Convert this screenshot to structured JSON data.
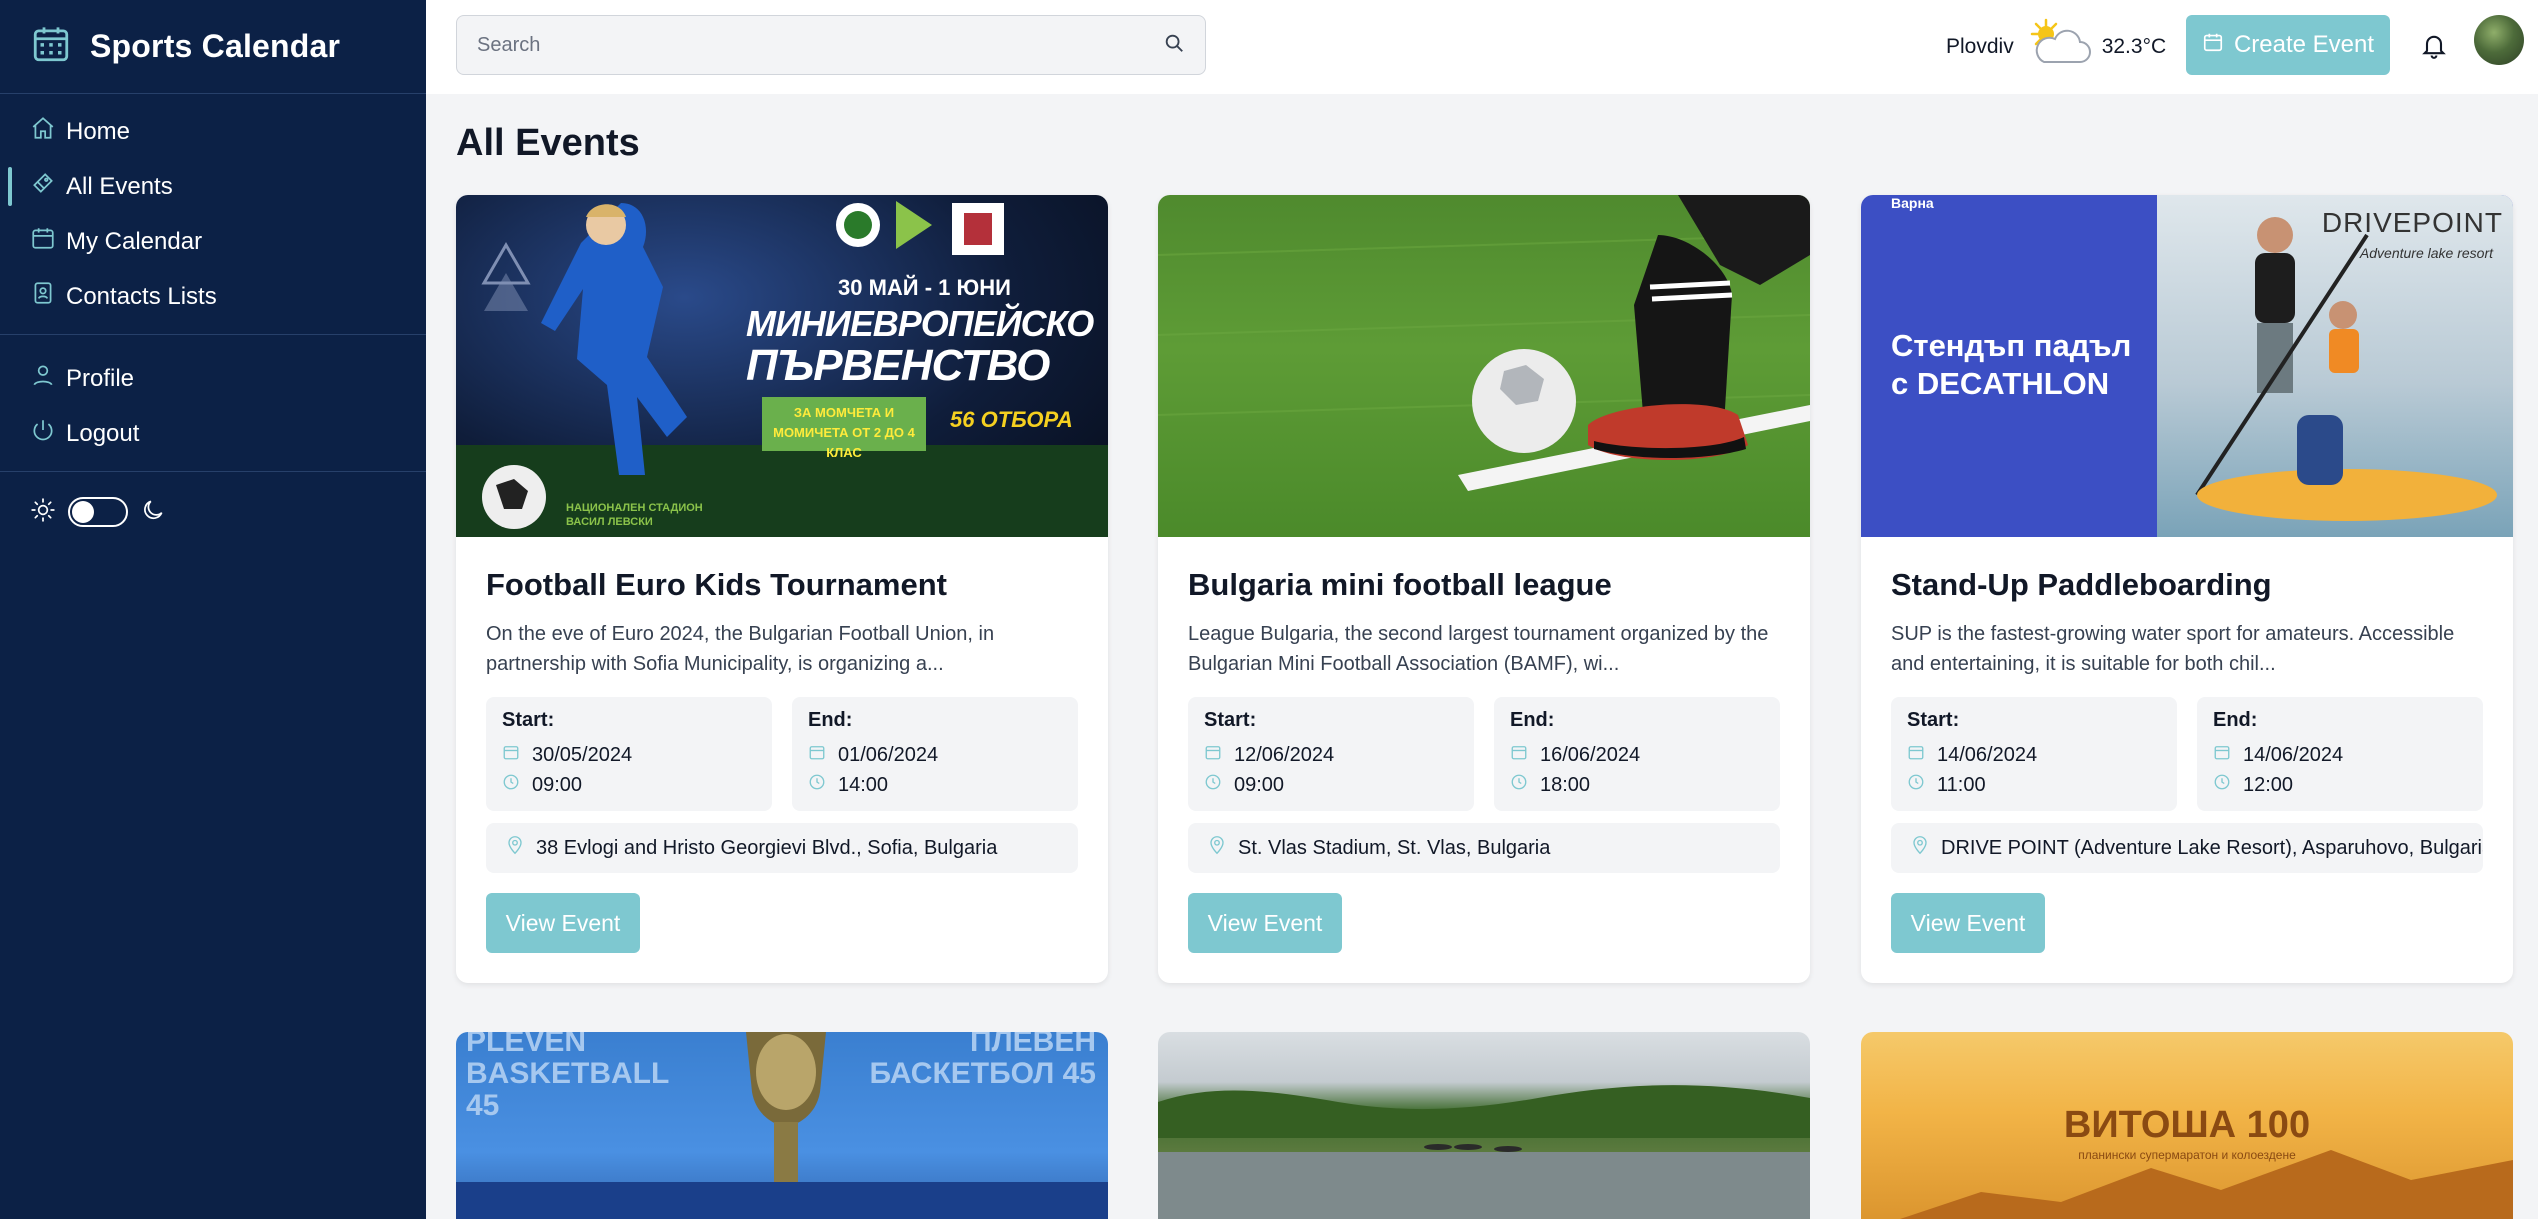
{
  "app": {
    "title": "Sports Calendar"
  },
  "sidebar": {
    "items": [
      {
        "label": "Home",
        "icon": "home-icon"
      },
      {
        "label": "All Events",
        "icon": "ticket-icon",
        "active": true
      },
      {
        "label": "My Calendar",
        "icon": "calendar-icon"
      },
      {
        "label": "Contacts Lists",
        "icon": "contacts-book-icon"
      }
    ],
    "account_items": [
      {
        "label": "Profile",
        "icon": "user-icon"
      },
      {
        "label": "Logout",
        "icon": "power-icon"
      }
    ],
    "theme_toggle": {
      "light_icon": "sun-icon",
      "dark_icon": "moon-icon",
      "dark_mode": false
    }
  },
  "topbar": {
    "search_placeholder": "Search",
    "weather": {
      "city": "Plovdiv",
      "temperature": "32.3°C",
      "icon": "partly-cloudy-icon"
    },
    "create_button": "Create Event"
  },
  "main": {
    "title": "All Events",
    "start_label": "Start:",
    "end_label": "End:",
    "view_button": "View Event",
    "events": [
      {
        "title": "Football Euro Kids Tournament",
        "description": "On the eve of Euro 2024, the Bulgarian Football Union, in partnership with Sofia Municipality, is organizing a...",
        "start_date": "30/05/2024",
        "start_time": "09:00",
        "end_date": "01/06/2024",
        "end_time": "14:00",
        "location": "38 Evlogi and Hristo Georgievi Blvd., Sofia, Bulgaria",
        "poster": {
          "dates": "30 МАЙ - 1 ЮНИ",
          "line1": "МИНИЕВРОПЕЙСКО",
          "line2": "ПЪРВЕНСТВО",
          "badge": "ЗА МОМЧЕТА И МОМИЧЕТА ОТ 2 ДО 4 КЛАС",
          "teams": "56 ОТБОРА",
          "venue": "НАЦИОНАЛЕН СТАДИОН ВАСИЛ ЛЕВСКИ"
        }
      },
      {
        "title": "Bulgaria mini football league",
        "description": "League Bulgaria, the second largest tournament organized by the Bulgarian Mini Football Association (BAMF), wi...",
        "start_date": "12/06/2024",
        "start_time": "09:00",
        "end_date": "16/06/2024",
        "end_time": "18:00",
        "location": "St. Vlas Stadium, St. Vlas, Bulgaria"
      },
      {
        "title": "Stand-Up Paddleboarding",
        "description": "SUP is the fastest-growing water sport for amateurs. Accessible and entertaining, it is suitable for both chil...",
        "start_date": "14/06/2024",
        "start_time": "11:00",
        "end_date": "14/06/2024",
        "end_time": "12:00",
        "location": "DRIVE POINT (Adventure Lake Resort), Asparuhovo, Bulgaria",
        "poster": {
          "city": "Варна",
          "headline": "Стендъп падъл с DECATHLON",
          "brand": "DRIVEPOINT",
          "tagline": "Adventure lake resort"
        }
      }
    ],
    "more_events": [
      {
        "poster": {
          "left": "PLEVEN BASKETBALL 45",
          "right": "ПЛЕВЕН БАСКЕТБОЛ 45"
        }
      },
      {
        "poster": {}
      },
      {
        "poster": {
          "title": "ВИТОША 100",
          "subtitle": "планински супермаратон и колоездене"
        }
      }
    ]
  },
  "colors": {
    "sidebar": "#0c2146",
    "accent": "#7ec8d0",
    "background": "#f3f4f6"
  }
}
